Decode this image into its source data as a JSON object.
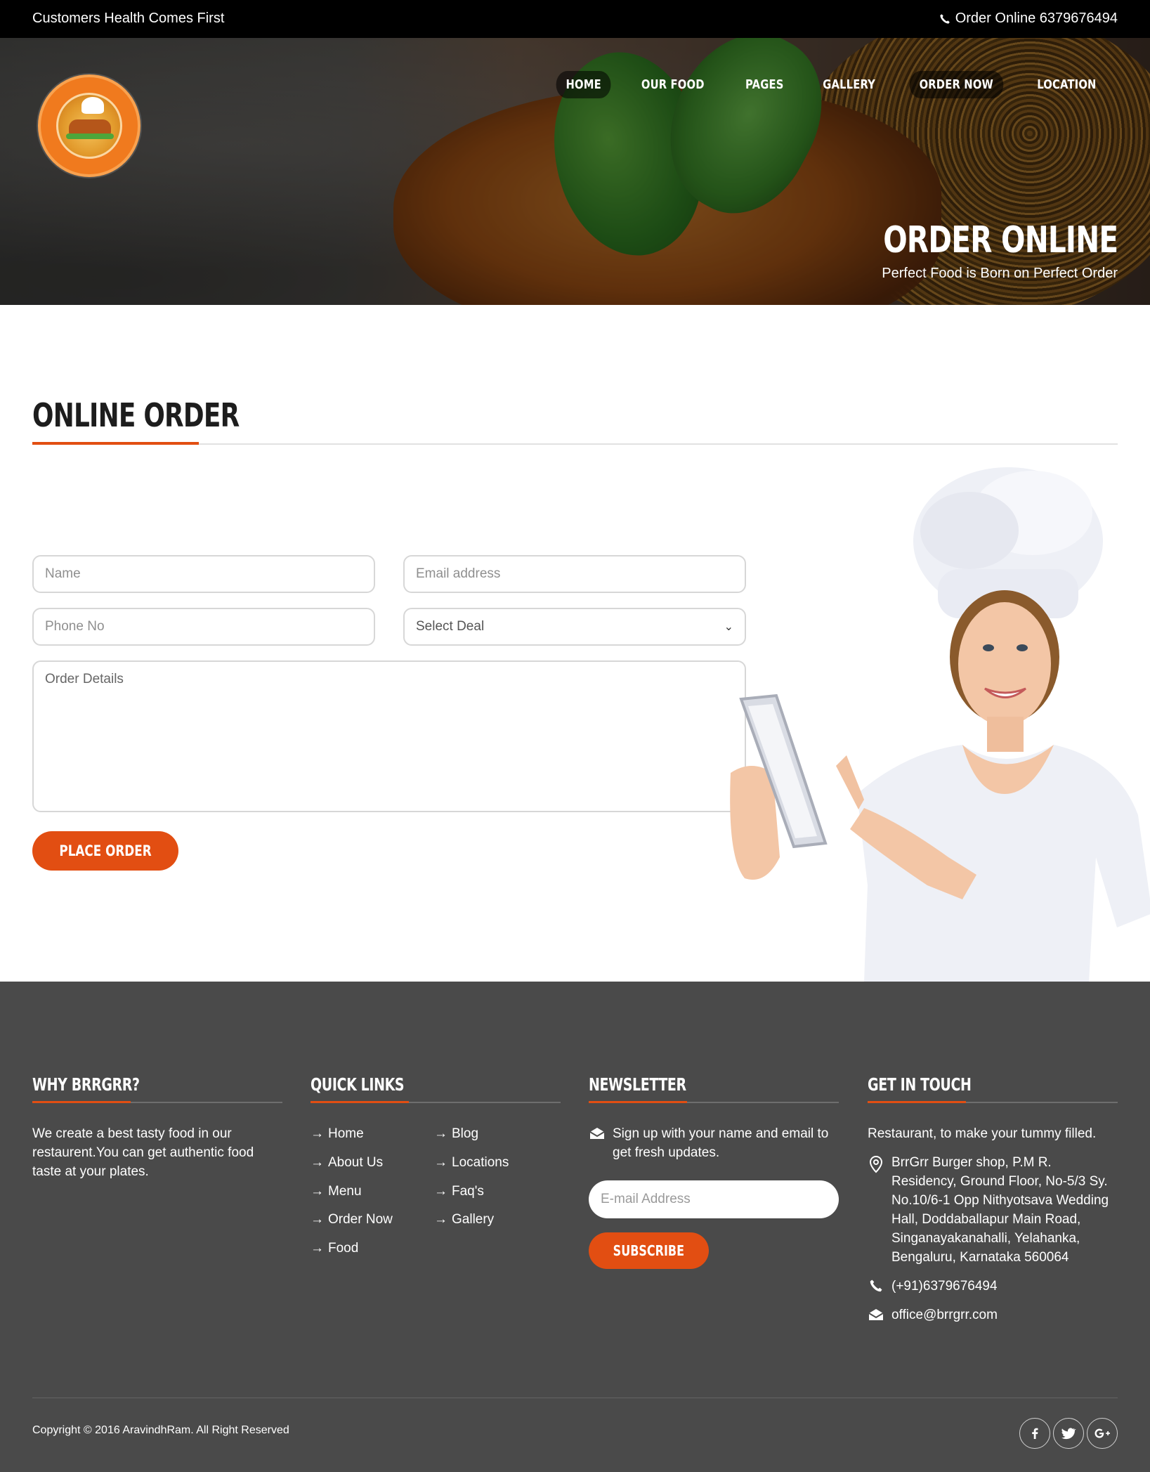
{
  "topbar": {
    "tagline": "Customers Health Comes First",
    "phone_text": "Order Online 6379676494",
    "phone_icon": "phone-icon"
  },
  "nav": {
    "items": [
      {
        "label": "HOME",
        "active": true
      },
      {
        "label": "OUR FOOD",
        "active": false
      },
      {
        "label": "PAGES",
        "active": false
      },
      {
        "label": "GALLERY",
        "active": false
      },
      {
        "label": "ORDER NOW",
        "active": true
      },
      {
        "label": "LOCATION",
        "active": false
      }
    ]
  },
  "hero": {
    "title": "ORDER ONLINE",
    "subtitle": "Perfect Food is Born on Perfect Order"
  },
  "main": {
    "title": "ONLINE ORDER",
    "form": {
      "name_placeholder": "Name",
      "email_placeholder": "Email address",
      "phone_placeholder": "Phone No",
      "deal_selected": "Select Deal",
      "details_placeholder": "Order Details",
      "submit_label": "PLACE ORDER"
    }
  },
  "footer": {
    "why": {
      "title": "WHY BRRGRR?",
      "text": "We create a best tasty food in our restaurent.You can get authentic food taste at your plates."
    },
    "quicklinks": {
      "title": "QUICK LINKS",
      "col1": [
        "Home",
        "About Us",
        "Menu",
        "Order Now",
        "Food"
      ],
      "col2": [
        "Blog",
        "Locations",
        "Faq's",
        "Gallery"
      ]
    },
    "newsletter": {
      "title": "NEWSLETTER",
      "text": "Sign up with your name and email to get fresh updates.",
      "email_placeholder": "E-mail Address",
      "subscribe_label": "SUBSCRIBE"
    },
    "contact": {
      "title": "GET IN TOUCH",
      "intro": "Restaurant, to make your tummy filled.",
      "address": "BrrGrr Burger shop, P.M R. Residency, Ground Floor, No-5/3 Sy. No.10/6-1 Opp Nithyotsava Wedding Hall, Doddaballapur Main Road, Singanayakanahalli, Yelahanka, Bengaluru, Karnataka 560064",
      "phone": "(+91)6379676494",
      "email": "office@brrgrr.com"
    },
    "copyright": "Copyright © 2016 AravindhRam. All Right Reserved",
    "social": [
      "facebook-icon",
      "twitter-icon",
      "google-plus-icon"
    ]
  },
  "colors": {
    "accent": "#e24e12",
    "topbar": "#000000",
    "footer_bg": "#4a4a4a"
  }
}
